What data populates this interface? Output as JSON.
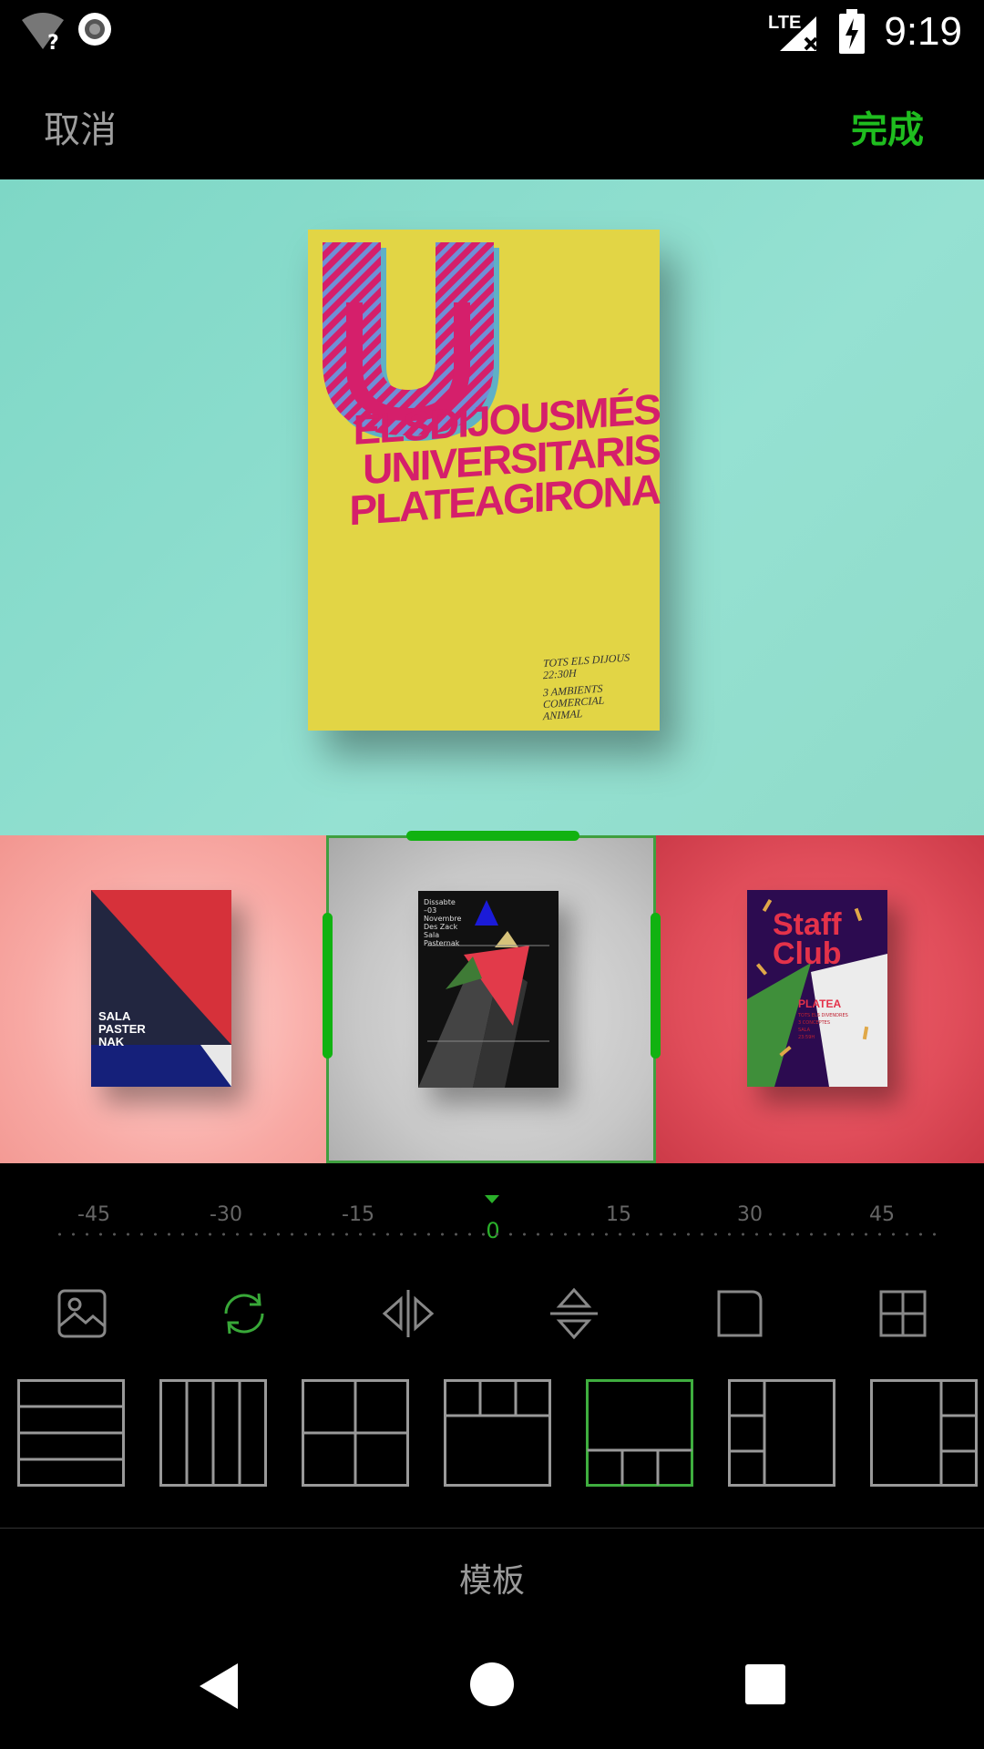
{
  "status_bar": {
    "time": "9:19",
    "network": "LTE",
    "icons": [
      "wifi-unknown-icon",
      "record-icon",
      "lte-signal-icon",
      "battery-charging-icon"
    ]
  },
  "top_bar": {
    "cancel_label": "取消",
    "done_label": "完成",
    "done_color": "#1fbd1f"
  },
  "main_photo": {
    "poster_headline": [
      "ELSDIJOUSMÉS",
      "UNIVERSITARIS",
      "PLATEAGIRONA"
    ],
    "poster_fine_print": [
      "TOTS ELS DIJOUS",
      "22:30H",
      "3 AMBIENTS",
      "COMERCIAL",
      "ANIMAL"
    ]
  },
  "thumbnails": [
    {
      "name": "sala-pasternak",
      "text": [
        "SALA",
        "PASTER",
        "NAK"
      ]
    },
    {
      "name": "dark-poster",
      "text": [
        "Dissabte",
        "–03",
        "Novembre",
        "Des Zack",
        "Sala",
        "Pasternak"
      ]
    },
    {
      "name": "staff-club",
      "text": [
        "Staff",
        "Club",
        "PLATEA",
        "TOTS ELS DIVENDRES",
        "3 CONCEPTES",
        "SALA",
        "23:59H"
      ]
    }
  ],
  "ruler": {
    "ticks": [
      "-45",
      "-30",
      "-15",
      "15",
      "30",
      "45"
    ],
    "current": "0"
  },
  "tools": [
    "image-icon",
    "rotate-icon",
    "flip-horizontal-icon",
    "flip-vertical-icon",
    "corner-icon",
    "grid-icon"
  ],
  "templates": {
    "selected_index": 4,
    "selected_color": "#3fae3f",
    "tab_label": "模板"
  }
}
